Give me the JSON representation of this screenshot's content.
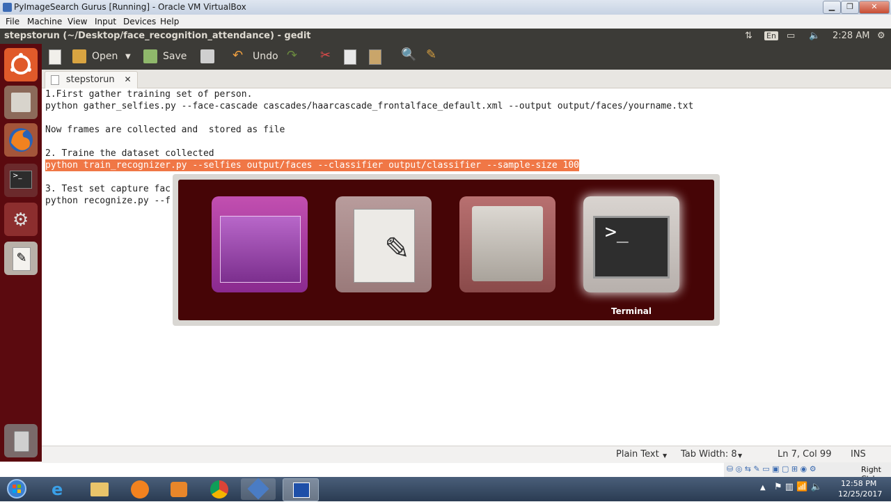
{
  "host_window": {
    "title": "PyImageSearch Gurus [Running] - Oracle VM VirtualBox",
    "menu": [
      "File",
      "Machine",
      "View",
      "Input",
      "Devices",
      "Help"
    ],
    "host_key": "Right Ctrl"
  },
  "panel": {
    "window_title": "stepstorun (~/Desktop/face_recognition_attendance) - gedit",
    "keyboard": "En",
    "time": "2:28 AM"
  },
  "toolbar": {
    "open_label": "Open",
    "save_label": "Save",
    "undo_label": "Undo"
  },
  "tab": {
    "label": "stepstorun",
    "close": "✕"
  },
  "editor": {
    "lines": [
      "1.First gather training set of person.",
      "python gather_selfies.py --face-cascade cascades/haarcascade_frontalface_default.xml --output output/faces/yourname.txt",
      "",
      "Now frames are collected and  stored as file",
      "",
      "2. Traine the dataset collected",
      "python train_recognizer.py --selfies output/faces --classifier output/classifier --sample-size 100",
      "",
      "3. Test set capture fac",
      "python recognize.py --f"
    ]
  },
  "switcher": {
    "selected_label": "Terminal"
  },
  "statusbar": {
    "language": "Plain Text",
    "tab_width": "Tab Width: 8",
    "position": "Ln 7, Col 99",
    "mode": "INS"
  },
  "taskbar": {
    "time": "12:58 PM",
    "date": "12/25/2017"
  },
  "colors": {
    "launcher_bg": "#5b0a0f",
    "switcher_bg": "#460506",
    "selection": "#f07746",
    "panel_bg": "#3c3b37"
  }
}
